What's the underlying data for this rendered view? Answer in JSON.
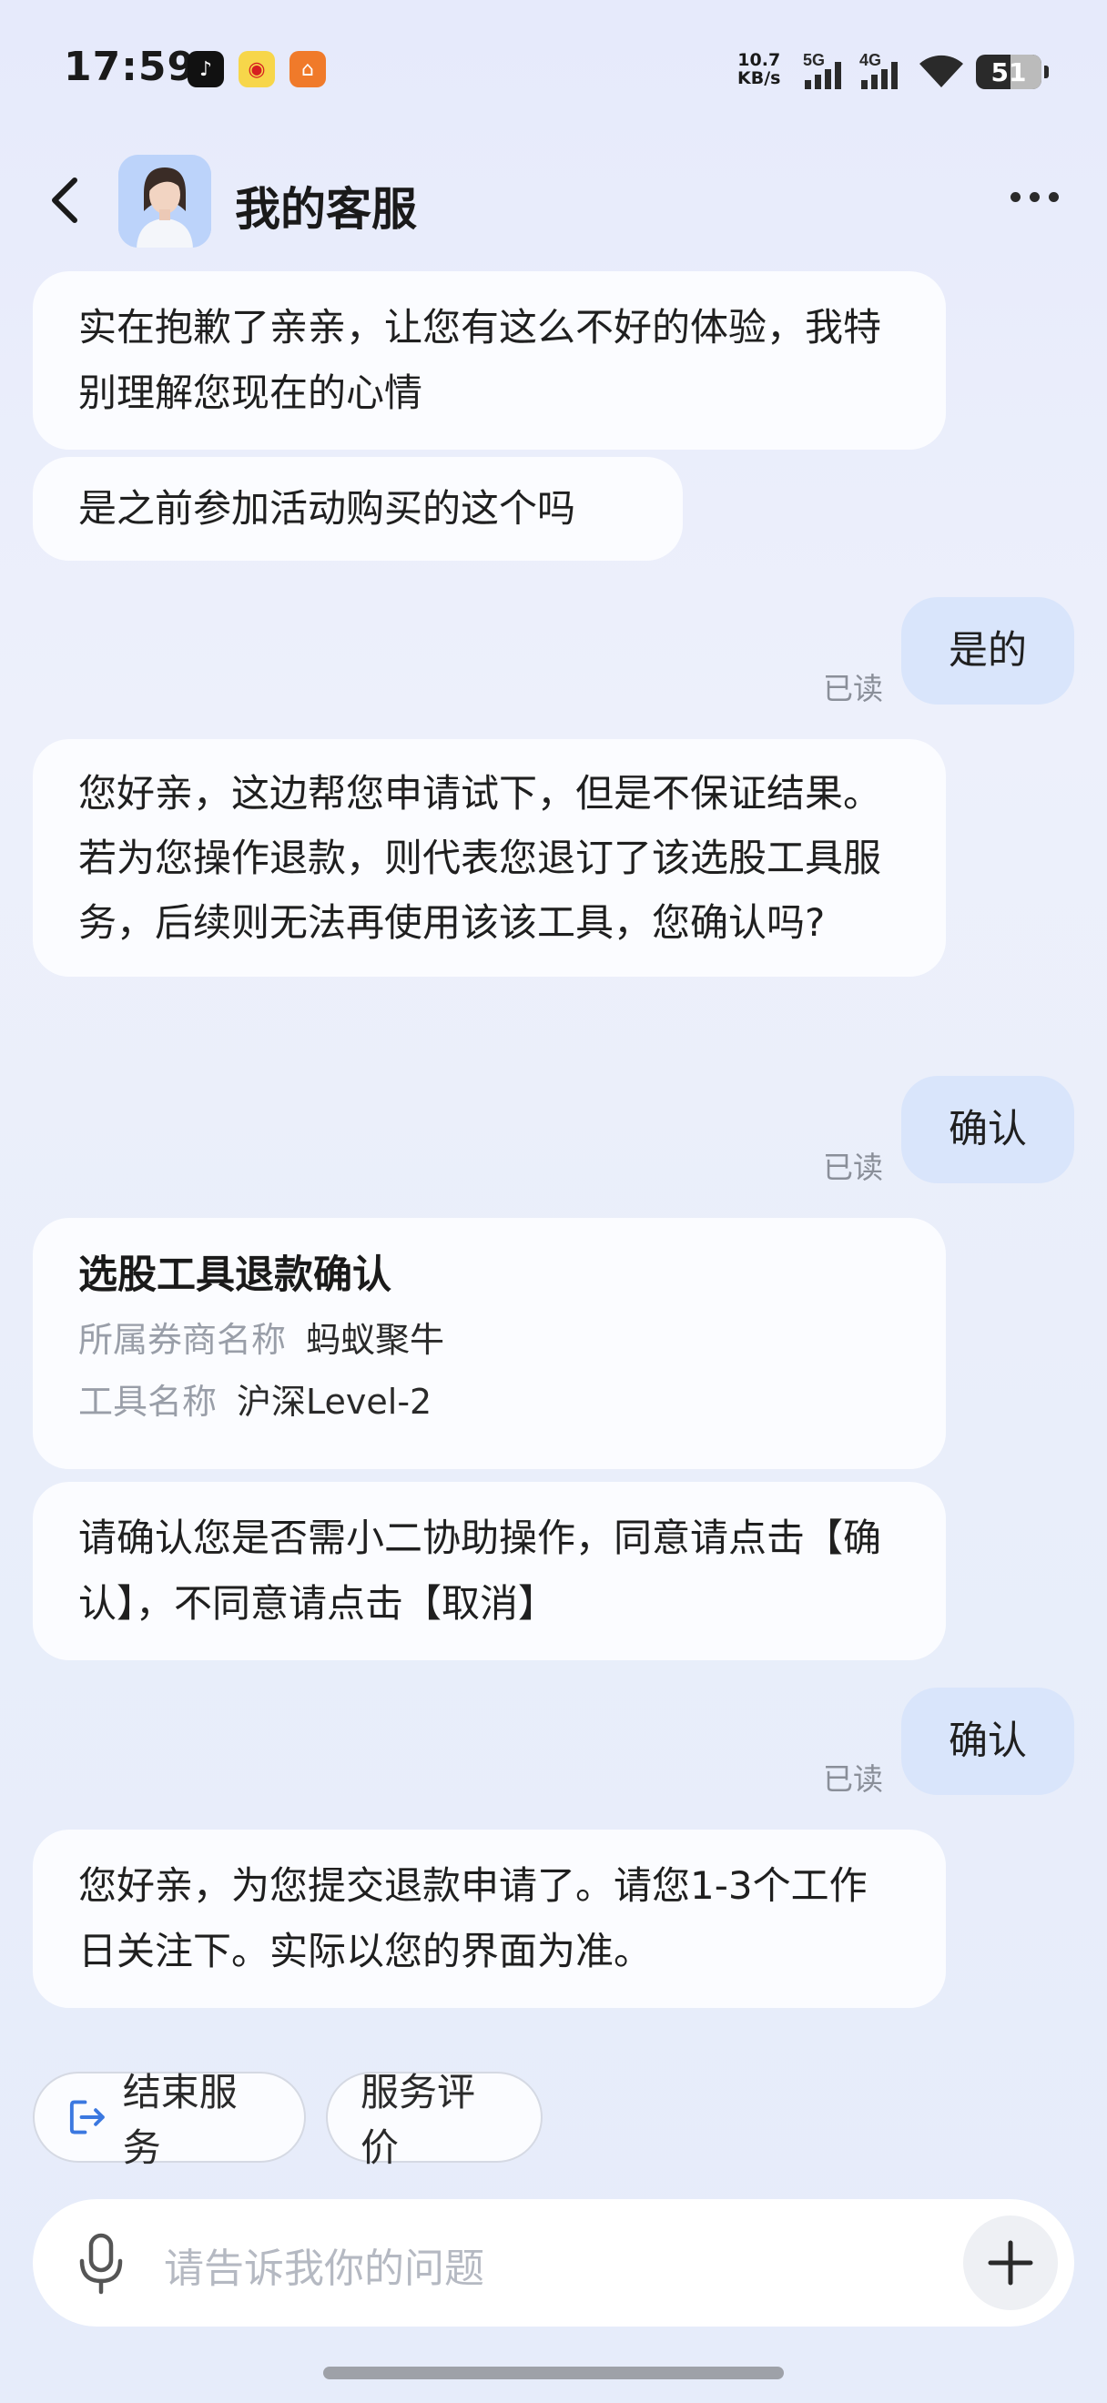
{
  "status_bar": {
    "time": "17:59",
    "net_speed_value": "10.7",
    "net_speed_unit": "KB/s",
    "signal1_label": "5G",
    "signal2_label": "4G",
    "battery": "51"
  },
  "header": {
    "title": "我的客服"
  },
  "messages": {
    "m1": "实在抱歉了亲亲，让您有这么不好的体验，我特别理解您现在的心情",
    "m2": "是之前参加活动购买的这个吗",
    "u1": "是的",
    "m3": "您好亲，这边帮您申请试下，但是不保证结果。若为您操作退款，则代表您退订了该选股工具服务，后续则无法再使用该该工具，您确认吗?",
    "u2": "确认",
    "card": {
      "title": "选股工具退款确认",
      "broker_label": "所属券商名称",
      "broker_value": "蚂蚁聚牛",
      "tool_label": "工具名称",
      "tool_value": "沪深Level-2"
    },
    "m4": "请确认您是否需小二协助操作，同意请点击【确认】，不同意请点击【取消】",
    "u3": "确认",
    "m5": "您好亲，为您提交退款申请了。请您1-3个工作日关注下。实际以您的界面为准。",
    "read_label": "已读"
  },
  "quick_actions": {
    "end_service": "结束服务",
    "rate_service": "服务评价"
  },
  "input": {
    "placeholder": "请告诉我你的问题"
  }
}
